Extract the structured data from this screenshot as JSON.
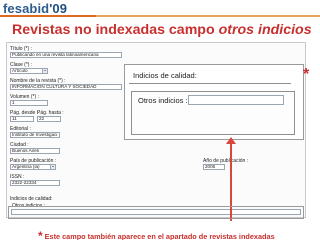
{
  "logo": {
    "name": "fesabid",
    "year": "'09"
  },
  "slide": {
    "title_plain": "Revistas no indexadas campo ",
    "title_em": "otros indicios"
  },
  "form": {
    "fields": [
      {
        "id": "titulo",
        "label": "Título (*) :",
        "value": "Publicando en una revista latinoamericana"
      },
      {
        "id": "clase",
        "label": "Clase (*) :",
        "value": "Artículo"
      },
      {
        "id": "revista",
        "label": "Nombre de la revista (*) :",
        "value": "INFORMACIÓN CULTURA Y SOCIEDAD"
      },
      {
        "id": "volumen",
        "label": "Volumen (*) :",
        "value": "1"
      },
      {
        "id": "pag_desde",
        "label": "Pág. desde :",
        "value": "11"
      },
      {
        "id": "pag_hasta",
        "label": "Pág. hasta :",
        "value": "22"
      },
      {
        "id": "editorial",
        "label": "Editorial :",
        "value": "Instituto de Investigaci"
      },
      {
        "id": "ciudad",
        "label": "Ciudad :",
        "value": "Buenos Aires"
      },
      {
        "id": "pais",
        "label": "País de publicación :",
        "value": "Argentina (la)"
      },
      {
        "id": "anio",
        "label": "Año de publicación :",
        "value": "2006"
      },
      {
        "id": "issn",
        "label": "ISSN :",
        "value": "2322-22334"
      }
    ],
    "calidad_label": "Indicios de calidad:",
    "otros_label": "Otros indicios :"
  },
  "zoom": {
    "calidad_label": "Indicios de calidad:",
    "otros_label": "Otros indicios :"
  },
  "annotations": {
    "asterisk": "*",
    "footnote_star": "*",
    "footnote": "Este campo también aparece en el apartado de revistas indexadas"
  },
  "colors": {
    "accent": "#c7302e",
    "brand": "#2e5d8f",
    "bar": "#e06a20"
  }
}
